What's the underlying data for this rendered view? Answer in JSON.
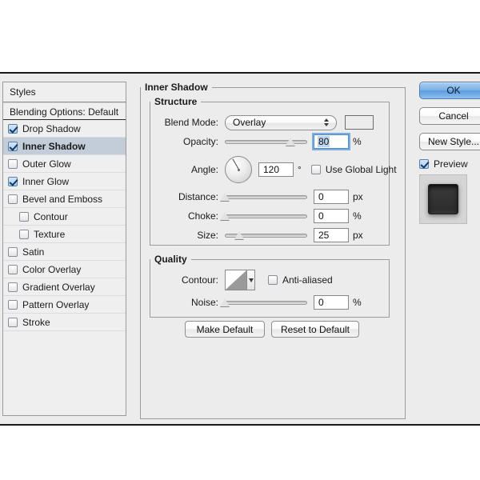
{
  "dialog": {
    "sidebar": {
      "header": "Styles",
      "blending_options": "Blending Options: Default",
      "items": [
        {
          "label": "Drop Shadow",
          "checked": true,
          "indent": false,
          "selected": false
        },
        {
          "label": "Inner Shadow",
          "checked": true,
          "indent": false,
          "selected": true
        },
        {
          "label": "Outer Glow",
          "checked": false,
          "indent": false,
          "selected": false
        },
        {
          "label": "Inner Glow",
          "checked": true,
          "indent": false,
          "selected": false
        },
        {
          "label": "Bevel and Emboss",
          "checked": false,
          "indent": false,
          "selected": false
        },
        {
          "label": "Contour",
          "checked": false,
          "indent": true,
          "selected": false
        },
        {
          "label": "Texture",
          "checked": false,
          "indent": true,
          "selected": false
        },
        {
          "label": "Satin",
          "checked": false,
          "indent": false,
          "selected": false
        },
        {
          "label": "Color Overlay",
          "checked": false,
          "indent": false,
          "selected": false
        },
        {
          "label": "Gradient Overlay",
          "checked": false,
          "indent": false,
          "selected": false
        },
        {
          "label": "Pattern Overlay",
          "checked": false,
          "indent": false,
          "selected": false
        },
        {
          "label": "Stroke",
          "checked": false,
          "indent": false,
          "selected": false
        }
      ]
    },
    "effect": {
      "title": "Inner Shadow",
      "structure": {
        "legend": "Structure",
        "blend_mode": {
          "label": "Blend Mode:",
          "value": "Overlay"
        },
        "color_swatch": "#000000",
        "opacity": {
          "label": "Opacity:",
          "value": "80",
          "unit": "%",
          "slider_percent": 80,
          "focused": true
        },
        "angle": {
          "label": "Angle:",
          "value": "120",
          "unit": "°",
          "degrees": 120
        },
        "use_global_light": {
          "label": "Use Global Light",
          "checked": false
        },
        "distance": {
          "label": "Distance:",
          "value": "0",
          "unit": "px",
          "slider_percent": 0
        },
        "choke": {
          "label": "Choke:",
          "value": "0",
          "unit": "%",
          "slider_percent": 0
        },
        "size": {
          "label": "Size:",
          "value": "25",
          "unit": "px",
          "slider_percent": 17
        }
      },
      "quality": {
        "legend": "Quality",
        "contour": {
          "label": "Contour:",
          "preset": "linear-contour"
        },
        "anti_aliased": {
          "label": "Anti-aliased",
          "checked": false
        },
        "noise": {
          "label": "Noise:",
          "value": "0",
          "unit": "%",
          "slider_percent": 0
        }
      },
      "make_default": "Make Default",
      "reset_to_default": "Reset to Default"
    },
    "actions": {
      "ok": "OK",
      "cancel": "Cancel",
      "new_style": "New Style...",
      "preview": {
        "label": "Preview",
        "checked": true
      }
    },
    "colors": {
      "dialog_background": "#ececec",
      "selection_highlight": "#c3cdd9",
      "primary_button": "#7fb2e6",
      "checkbox_accent": "#a9cdf0",
      "swatch": "#000000"
    }
  }
}
